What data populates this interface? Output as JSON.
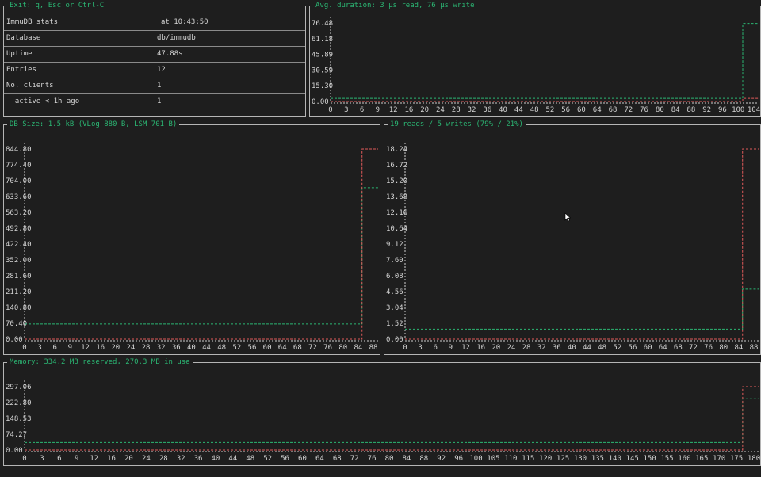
{
  "stats_panel": {
    "title": "Exit: q, Esc or Ctrl-C",
    "rows": [
      {
        "label": "ImmuDB stats",
        "value": "at 10:43:50"
      },
      {
        "label": "Database",
        "value": "db/immudb"
      },
      {
        "label": "Uptime",
        "value": "47.88s"
      },
      {
        "label": "Entries",
        "value": "12"
      },
      {
        "label": "No. clients",
        "value": "1"
      },
      {
        "label": "  active < 1h ago",
        "value": "1"
      }
    ]
  },
  "colors": {
    "read": "#2bb673",
    "write": "#e05a5a",
    "border": "#b5b5b5",
    "title": "#2bb673"
  },
  "chart_data": [
    {
      "type": "line",
      "title": "Avg. duration: 3 µs read, 76 µs write",
      "y_ticks": [
        "76.48",
        "61.18",
        "45.89",
        "30.59",
        "15.30",
        "0.00"
      ],
      "x_ticks": [
        "0",
        "3",
        "6",
        "9",
        "12",
        "16",
        "20",
        "24",
        "28",
        "32",
        "36",
        "40",
        "44",
        "48",
        "52",
        "56",
        "60",
        "64",
        "68",
        "72",
        "76",
        "80",
        "84",
        "88",
        "92",
        "96",
        "100",
        "104"
      ],
      "ylim": [
        0,
        76.48
      ],
      "xlim": [
        0,
        108
      ],
      "series": [
        {
          "color": "read",
          "x": [
            0,
            104,
            104,
            108
          ],
          "y": [
            3,
            3,
            76,
            76
          ]
        },
        {
          "color": "write",
          "x": [
            0,
            104,
            104,
            108
          ],
          "y": [
            0,
            0,
            3,
            3
          ]
        }
      ]
    },
    {
      "type": "line",
      "title": "DB Size: 1.5 kB (VLog 880 B, LSM 701 B)",
      "y_ticks": [
        "844.80",
        "774.40",
        "704.00",
        "633.60",
        "563.20",
        "492.80",
        "422.40",
        "352.00",
        "281.60",
        "211.20",
        "140.80",
        "70.40",
        "0.00"
      ],
      "x_ticks": [
        "0",
        "3",
        "6",
        "9",
        "12",
        "16",
        "20",
        "24",
        "28",
        "32",
        "36",
        "40",
        "44",
        "48",
        "52",
        "56",
        "60",
        "64",
        "68",
        "72",
        "76",
        "80",
        "84",
        "88"
      ],
      "ylim": [
        0,
        880
      ],
      "xlim": [
        0,
        88
      ],
      "series": [
        {
          "color": "read",
          "x": [
            0,
            84,
            84,
            88
          ],
          "y": [
            70,
            70,
            701,
            701
          ]
        },
        {
          "color": "write",
          "x": [
            0,
            84,
            84,
            88
          ],
          "y": [
            0,
            0,
            880,
            880
          ]
        }
      ]
    },
    {
      "type": "line",
      "title": "19 reads / 5 writes (79% / 21%)",
      "y_ticks": [
        "18.24",
        "16.72",
        "15.20",
        "13.68",
        "12.16",
        "10.64",
        "9.12",
        "7.60",
        "6.08",
        "4.56",
        "3.04",
        "1.52",
        "0.00"
      ],
      "x_ticks": [
        "0",
        "3",
        "6",
        "9",
        "12",
        "16",
        "20",
        "24",
        "28",
        "32",
        "36",
        "40",
        "44",
        "48",
        "52",
        "56",
        "60",
        "64",
        "68",
        "72",
        "76",
        "80",
        "84",
        "88"
      ],
      "ylim": [
        0,
        19
      ],
      "xlim": [
        0,
        88
      ],
      "series": [
        {
          "color": "read",
          "x": [
            0,
            84,
            84,
            88
          ],
          "y": [
            1,
            1,
            5,
            5
          ]
        },
        {
          "color": "write",
          "x": [
            0,
            84,
            84,
            88
          ],
          "y": [
            0,
            0,
            19,
            19
          ]
        }
      ]
    },
    {
      "type": "line",
      "title": "Memory: 334.2 MB reserved, 270.3 MB in use",
      "y_ticks": [
        "297.06",
        "222.80",
        "148.53",
        "74.27",
        "0.00"
      ],
      "x_ticks": [
        "0",
        "3",
        "6",
        "9",
        "12",
        "16",
        "20",
        "24",
        "28",
        "32",
        "36",
        "40",
        "44",
        "48",
        "52",
        "56",
        "60",
        "64",
        "68",
        "72",
        "76",
        "80",
        "84",
        "88",
        "92",
        "96",
        "100",
        "105",
        "110",
        "115",
        "120",
        "125",
        "130",
        "135",
        "140",
        "145",
        "150",
        "155",
        "160",
        "165",
        "170",
        "175",
        "180"
      ],
      "ylim": [
        0,
        334.2
      ],
      "xlim": [
        0,
        184
      ],
      "series": [
        {
          "color": "read",
          "x": [
            0,
            180,
            180,
            184
          ],
          "y": [
            40,
            40,
            270.3,
            270.3
          ]
        },
        {
          "color": "write",
          "x": [
            0,
            180,
            180,
            184
          ],
          "y": [
            0,
            0,
            334.2,
            334.2
          ]
        }
      ]
    }
  ]
}
